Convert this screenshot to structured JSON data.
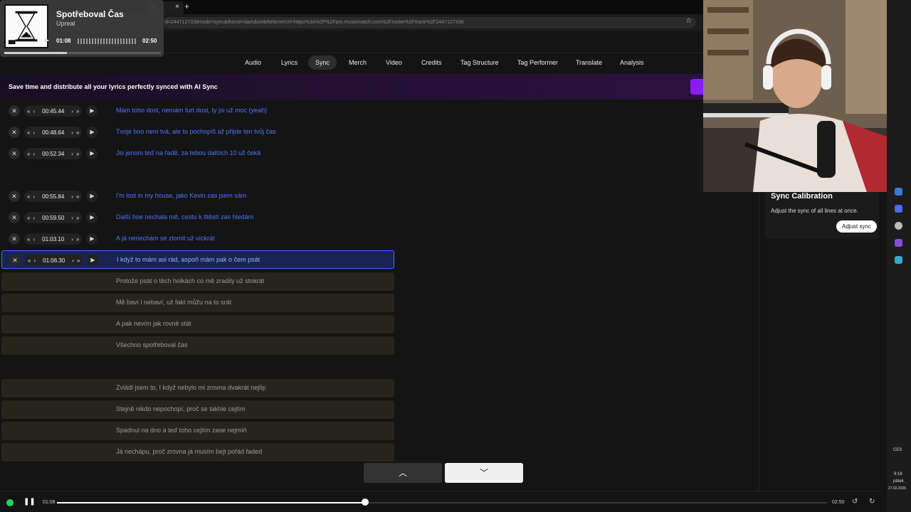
{
  "browser": {
    "tab_fragment": "o",
    "tab_close": "×",
    "new_tab": "+",
    "url": "d=2447127338mode=sync&theme=dark&webReferrerUrl=https%3A%2F%2Fpro.musixmatch.com%2Froster%2Ftrack%2F2447127338",
    "star": "☆"
  },
  "media": {
    "title": "Spotřeboval Čas",
    "artist": "Upreal",
    "current": "01:08",
    "duration": "02:50",
    "progress": 0.4
  },
  "nav": {
    "items": [
      "Audio",
      "Lyrics",
      "Sync",
      "Merch",
      "Video",
      "Credits",
      "Tag Structure",
      "Tag Performer",
      "Translate",
      "Analysis"
    ],
    "active": "Sync"
  },
  "banner": {
    "text": "Save time and distribute all your lyrics perfectly synced with AI Sync"
  },
  "controls": {
    "remove": "✕",
    "skip_back": "«",
    "back": "‹",
    "forward": "›",
    "skip_forward": "»",
    "play": "▶"
  },
  "synced_lines": [
    {
      "time": "00:45.44",
      "text": "Mám toho dost, nemám furt dost, ty jsi už moc (yeah)"
    },
    {
      "time": "00:48.64",
      "text": "Tvoje boo není tvá, ale to pochopíš až přijde ten tvůj čas"
    },
    {
      "time": "00:52.34",
      "text": "Jsi jenom teď na řadě, za tebou dalších 10 už čeká"
    },
    {
      "time": "00:55.84",
      "text": "I'm lost in my house, jako Kevin zas jsem sám"
    },
    {
      "time": "00:59.50",
      "text": "Další hoe nechala mě, cestu k štěstí zas hledám"
    },
    {
      "time": "01:03.10",
      "text": "A já nenechám se zlomit už víckrát"
    }
  ],
  "active_line": {
    "time": "01:06.30",
    "text": "I když to mám asi rád, aspoň mám pak o čem psát"
  },
  "pending_lines": [
    "Protože psát o těch holkách co mě zradily už stokrát",
    "Mě baví i nebaví, už fakt můžu na to srát",
    "A pak nevím jak rovně stát",
    "Všechno spotřeboval čas",
    "Zvládl jsem to, I když nebylo mi zrovna dvakrát nejlíp",
    "Stejně nikdo nepochopí, proč se takhle cejtím",
    "Spadnul na dno a teď toho cejtím zase nejmíň",
    "Já nechápu, proč zrovna já musím bejt pořád faded"
  ],
  "bottom_nav": {
    "up": "︿",
    "down": "﹀"
  },
  "player": {
    "current": "01:08",
    "duration": "02:50",
    "progress": 0.4,
    "pause": "❚❚",
    "rewind": "↺",
    "forward": "↻"
  },
  "calibration": {
    "title": "Sync Calibration",
    "description": "Adjust the sync of all lines at once.",
    "button": "Adjust sync"
  },
  "taskbar": {
    "lang": "CES",
    "time": "9:16",
    "day": "pátek",
    "date": "27.02.2026"
  },
  "colors": {
    "synced": "#4f76ff",
    "active_border": "#3f6fff",
    "pending_bg": "#27241b",
    "accent": "#8a1dff"
  }
}
